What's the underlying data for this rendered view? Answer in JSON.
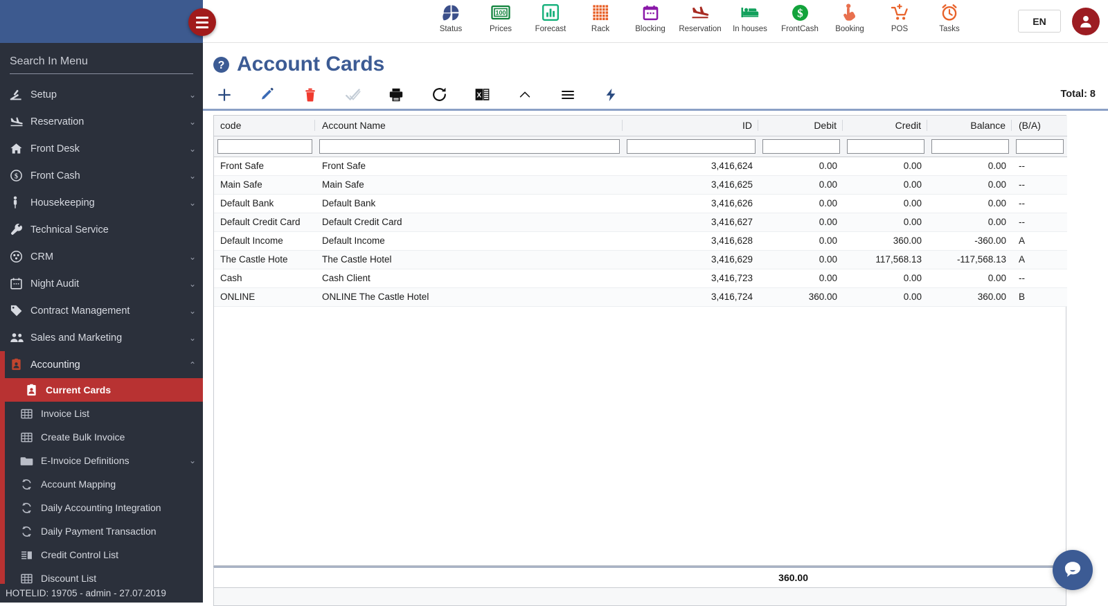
{
  "topbar": {
    "menu_toggle": "menu-toggle",
    "language": "EN",
    "nav_items": [
      {
        "label": "Status",
        "icon": "pie-chart-icon"
      },
      {
        "label": "Prices",
        "icon": "price-tag-100-icon"
      },
      {
        "label": "Forecast",
        "icon": "bar-chart-icon"
      },
      {
        "label": "Rack",
        "icon": "grid-squares-icon"
      },
      {
        "label": "Blocking",
        "icon": "calendar-icon"
      },
      {
        "label": "Reservation",
        "icon": "plane-landing-icon"
      },
      {
        "label": "In houses",
        "icon": "bed-icon"
      },
      {
        "label": "FrontCash",
        "icon": "dollar-circle-icon"
      },
      {
        "label": "Booking",
        "icon": "hand-click-icon"
      },
      {
        "label": "POS",
        "icon": "shopping-cart-plus-icon"
      },
      {
        "label": "Tasks",
        "icon": "alarm-clock-icon"
      }
    ]
  },
  "sidebar": {
    "search_placeholder": "Search In Menu",
    "items": [
      {
        "label": "Setup",
        "icon": "tools-icon",
        "chevron": "down",
        "level": 0
      },
      {
        "label": "Reservation",
        "icon": "plane-landing-icon",
        "chevron": "down",
        "level": 0
      },
      {
        "label": "Front Desk",
        "icon": "home-icon",
        "chevron": "down",
        "level": 0
      },
      {
        "label": "Front Cash",
        "icon": "dollar-circle-icon",
        "chevron": "down",
        "level": 0
      },
      {
        "label": "Housekeeping",
        "icon": "person-icon",
        "chevron": "down",
        "level": 0
      },
      {
        "label": "Technical Service",
        "icon": "wrench-icon",
        "chevron": "",
        "level": 0
      },
      {
        "label": "CRM",
        "icon": "people-circle-icon",
        "chevron": "down",
        "level": 0
      },
      {
        "label": "Night Audit",
        "icon": "calendar-icon",
        "chevron": "down",
        "level": 0
      },
      {
        "label": "Contract Management",
        "icon": "tag-icon",
        "chevron": "down",
        "level": 0
      },
      {
        "label": "Sales and Marketing",
        "icon": "people-icon",
        "chevron": "down",
        "level": 0
      },
      {
        "label": "Accounting",
        "icon": "id-card-icon",
        "chevron": "up",
        "level": 0,
        "expanded": true
      },
      {
        "label": "Current Cards",
        "icon": "id-card-icon",
        "chevron": "",
        "level": 1,
        "selected": true
      },
      {
        "label": "Invoice List",
        "icon": "table-grid-icon",
        "chevron": "",
        "level": 1
      },
      {
        "label": "Create Bulk Invoice",
        "icon": "table-grid-icon",
        "chevron": "",
        "level": 1
      },
      {
        "label": "E-Invoice Definitions",
        "icon": "folder-icon",
        "chevron": "down",
        "level": 1
      },
      {
        "label": "Account Mapping",
        "icon": "sync-icon",
        "chevron": "",
        "level": 1
      },
      {
        "label": "Daily Accounting Integration",
        "icon": "sync-icon",
        "chevron": "",
        "level": 1
      },
      {
        "label": "Daily Payment Transaction",
        "icon": "sync-icon",
        "chevron": "",
        "level": 1
      },
      {
        "label": "Credit Control List",
        "icon": "list-bars-icon",
        "chevron": "",
        "level": 1
      },
      {
        "label": "Discount List",
        "icon": "table-grid-icon",
        "chevron": "",
        "level": 1
      }
    ],
    "status": "HOTELID: 19705 - admin - 27.07.2019"
  },
  "page": {
    "title": "Account Cards",
    "help_icon": "question-mark-circle-icon",
    "total_label": "Total: 8"
  },
  "toolbar": {
    "buttons": [
      {
        "name": "add-button",
        "icon": "plus-icon",
        "title": "Add"
      },
      {
        "name": "edit-button",
        "icon": "pencil-icon",
        "title": "Edit"
      },
      {
        "name": "delete-button",
        "icon": "trash-icon",
        "title": "Delete"
      },
      {
        "name": "approve-button",
        "icon": "check-icon",
        "title": "Approve"
      },
      {
        "name": "print-button",
        "icon": "printer-icon",
        "title": "Print"
      },
      {
        "name": "refresh-button",
        "icon": "refresh-icon",
        "title": "Refresh"
      },
      {
        "name": "excel-button",
        "icon": "excel-icon",
        "title": "Export to Excel"
      },
      {
        "name": "collapse-button",
        "icon": "chevron-up-icon",
        "title": "Collapse"
      },
      {
        "name": "menu-button",
        "icon": "hamburger-icon",
        "title": "Menu"
      },
      {
        "name": "actions-button",
        "icon": "lightning-icon",
        "title": "Actions"
      }
    ]
  },
  "grid": {
    "columns": [
      {
        "key": "code",
        "label": "code",
        "align": "l"
      },
      {
        "key": "accountName",
        "label": "Account Name",
        "align": "l"
      },
      {
        "key": "id",
        "label": "ID",
        "align": "r"
      },
      {
        "key": "debit",
        "label": "Debit",
        "align": "r"
      },
      {
        "key": "credit",
        "label": "Credit",
        "align": "r"
      },
      {
        "key": "balance",
        "label": "Balance",
        "align": "r"
      },
      {
        "key": "ba",
        "label": "(B/A)",
        "align": "l"
      }
    ],
    "filters": [
      "",
      "",
      "",
      "",
      "",
      "",
      ""
    ],
    "rows": [
      {
        "code": "Front Safe",
        "accountName": "Front Safe",
        "id": "3,416,624",
        "debit": "0.00",
        "credit": "0.00",
        "balance": "0.00",
        "ba": "--"
      },
      {
        "code": "Main Safe",
        "accountName": "Main Safe",
        "id": "3,416,625",
        "debit": "0.00",
        "credit": "0.00",
        "balance": "0.00",
        "ba": "--"
      },
      {
        "code": "Default Bank",
        "accountName": "Default Bank",
        "id": "3,416,626",
        "debit": "0.00",
        "credit": "0.00",
        "balance": "0.00",
        "ba": "--"
      },
      {
        "code": "Default Credit Card",
        "accountName": "Default Credit Card",
        "id": "3,416,627",
        "debit": "0.00",
        "credit": "0.00",
        "balance": "0.00",
        "ba": "--"
      },
      {
        "code": "Default Income",
        "accountName": "Default Income",
        "id": "3,416,628",
        "debit": "0.00",
        "credit": "360.00",
        "balance": "-360.00",
        "ba": "A"
      },
      {
        "code": "The Castle Hote",
        "accountName": "The Castle Hotel",
        "id": "3,416,629",
        "debit": "0.00",
        "credit": "117,568.13",
        "balance": "-117,568.13",
        "ba": "A"
      },
      {
        "code": "Cash",
        "accountName": "Cash Client",
        "id": "3,416,723",
        "debit": "0.00",
        "credit": "0.00",
        "balance": "0.00",
        "ba": "--"
      },
      {
        "code": "ONLINE",
        "accountName": "ONLINE The Castle Hotel",
        "id": "3,416,724",
        "debit": "360.00",
        "credit": "0.00",
        "balance": "360.00",
        "ba": "B"
      }
    ],
    "footer_total": "360.00"
  },
  "chat": {
    "icon": "chat-bubble-icon"
  },
  "colors": {
    "header_blue": "#3d5a8f",
    "sidebar_dark": "#2b303b",
    "accent_red": "#b83232",
    "title_blue": "#3c5b94"
  }
}
